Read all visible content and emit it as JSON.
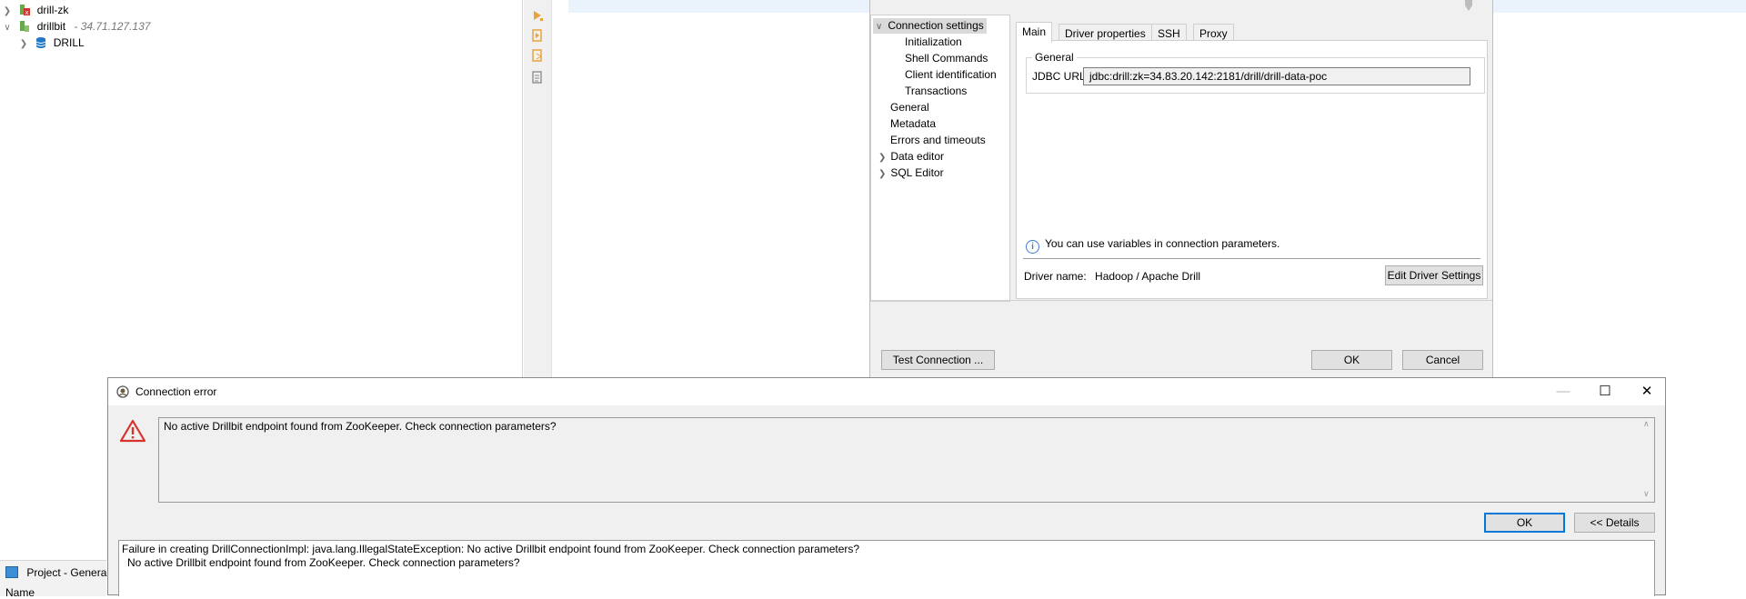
{
  "navigator": {
    "items": [
      {
        "label": "drill-zk",
        "host": ""
      },
      {
        "label": "drillbit",
        "host": "- 34.71.127.137"
      },
      {
        "label": "DRILL",
        "host": ""
      }
    ],
    "bottom_tab": "Project - General",
    "column_header": "Name"
  },
  "connection_dialog": {
    "nav": {
      "connection_settings": "Connection settings",
      "initialization": "Initialization",
      "shell_commands": "Shell Commands",
      "client_identification": "Client identification",
      "transactions": "Transactions",
      "general": "General",
      "metadata": "Metadata",
      "errors_and_timeouts": "Errors and timeouts",
      "data_editor": "Data editor",
      "sql_editor": "SQL Editor"
    },
    "tabs": [
      "Main",
      "Driver properties",
      "SSH",
      "Proxy"
    ],
    "group_title": "General",
    "jdbc_label": "JDBC URL:",
    "jdbc_value": "jdbc:drill:zk=34.83.20.142:2181/drill/drill-data-poc",
    "variables_hint": "You can use variables in connection parameters.",
    "driver_name_label": "Driver name:",
    "driver_name_value": "Hadoop / Apache Drill",
    "edit_driver_button": "Edit Driver Settings",
    "test_connection_button": "Test Connection ...",
    "ok_button": "OK",
    "cancel_button": "Cancel"
  },
  "error_dialog": {
    "title": "Connection error",
    "message": "No active Drillbit endpoint found from ZooKeeper. Check connection parameters?",
    "ok_button": "OK",
    "details_button": "<< Details",
    "details_line1": "Failure in creating DrillConnectionImpl: java.lang.IllegalStateException: No active Drillbit endpoint found from ZooKeeper. Check connection parameters?",
    "details_line2": "No active Drillbit endpoint found from ZooKeeper. Check connection parameters?"
  },
  "colors": {
    "accent": "#0078d7",
    "error_icon": "#d9322c",
    "db_icon": "#1f78c8",
    "warning_orange": "#e8a33b"
  },
  "icons": [
    "expand-icon",
    "collapse-icon",
    "connection-icon",
    "database-icon",
    "run-script-icon",
    "warning-icon",
    "info-icon",
    "minimize-icon",
    "maximize-icon",
    "close-icon"
  ]
}
